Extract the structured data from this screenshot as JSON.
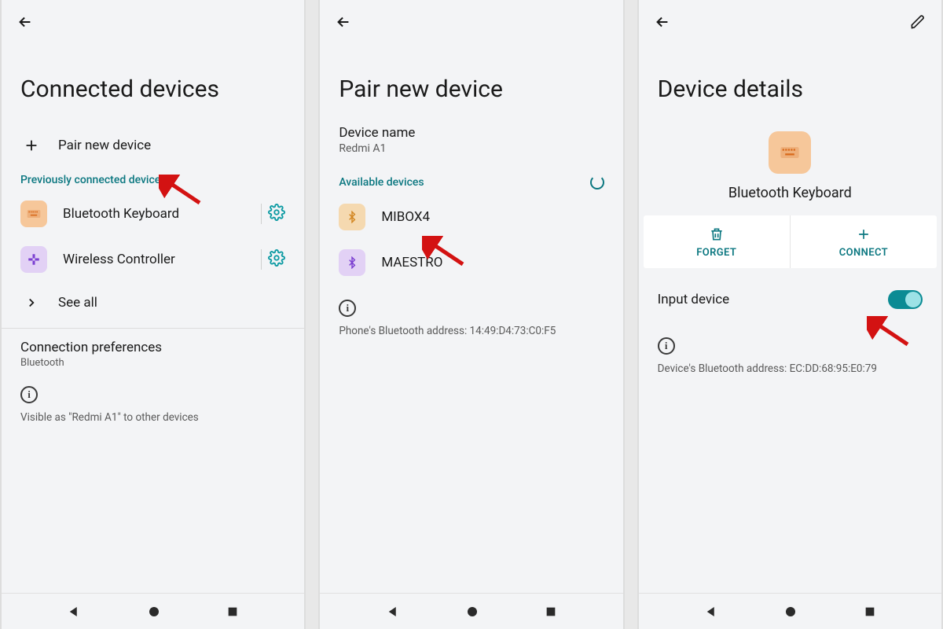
{
  "colors": {
    "teal": "#0b7780",
    "tealIcon": "#0b9aa2"
  },
  "screen1": {
    "title": "Connected devices",
    "pair_new": "Pair new device",
    "prev_header": "Previously connected devices",
    "devices": [
      {
        "name": "Bluetooth Keyboard",
        "icon": "keyboard",
        "tint": "orange"
      },
      {
        "name": "Wireless Controller",
        "icon": "gamepad",
        "tint": "purple"
      }
    ],
    "see_all": "See all",
    "connection_prefs": {
      "title": "Connection preferences",
      "subtitle": "Bluetooth"
    },
    "visibility_note": "Visible as \"Redmi A1\" to other devices"
  },
  "screen2": {
    "title": "Pair new device",
    "device_name_label": "Device name",
    "device_name_value": "Redmi A1",
    "available_header": "Available devices",
    "available": [
      {
        "name": "MIBOX4",
        "tint": "lorange"
      },
      {
        "name": "MAESTRO",
        "tint": "purple"
      }
    ],
    "bt_address_label": "Phone's Bluetooth address: 14:49:D4:73:C0:F5"
  },
  "screen3": {
    "title": "Device details",
    "device_name": "Bluetooth Keyboard",
    "forget": "FORGET",
    "connect": "CONNECT",
    "input_device_label": "Input device",
    "input_device_on": true,
    "bt_address_label": "Device's Bluetooth address: EC:DD:68:95:E0:79"
  }
}
